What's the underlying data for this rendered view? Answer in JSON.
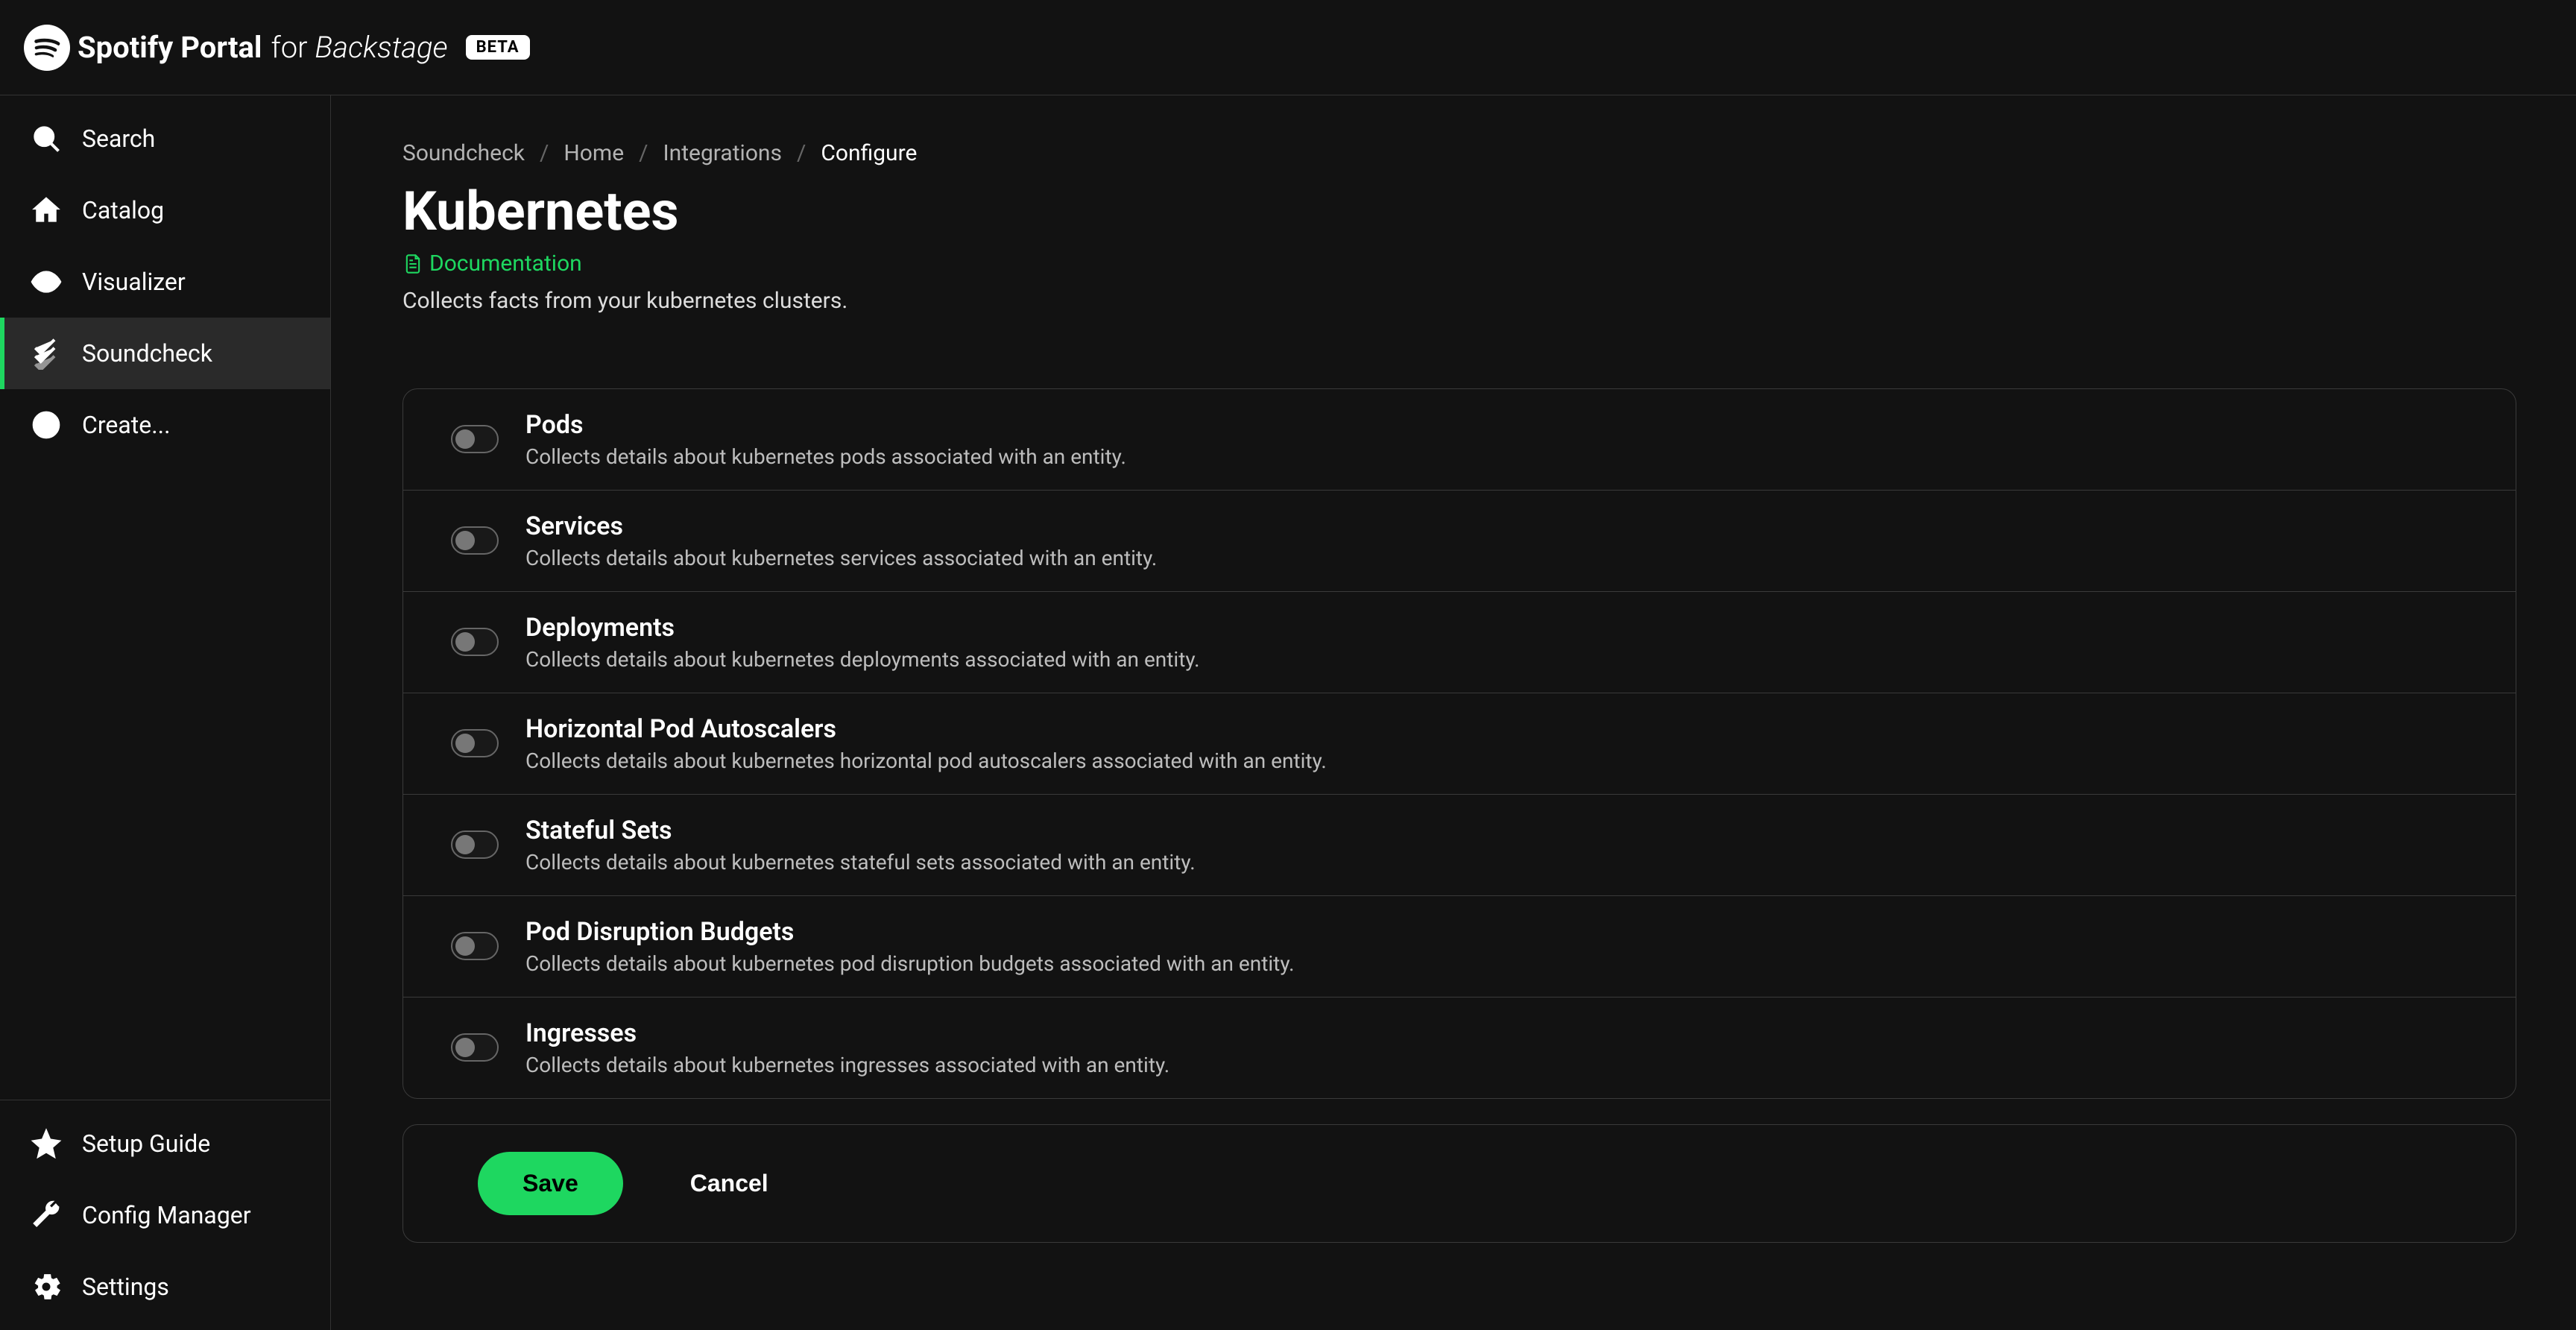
{
  "brand": {
    "name_bold": "Spotify Portal",
    "name_light_prefix": "for",
    "name_light_suffix": "Backstage",
    "badge": "BETA"
  },
  "sidebar": {
    "top": [
      {
        "label": "Search",
        "icon": "search"
      },
      {
        "label": "Catalog",
        "icon": "home"
      },
      {
        "label": "Visualizer",
        "icon": "eye"
      },
      {
        "label": "Soundcheck",
        "icon": "check-layers",
        "active": true
      },
      {
        "label": "Create...",
        "icon": "plus-circle"
      }
    ],
    "bottom": [
      {
        "label": "Setup Guide",
        "icon": "star"
      },
      {
        "label": "Config Manager",
        "icon": "wrench"
      },
      {
        "label": "Settings",
        "icon": "gear"
      }
    ]
  },
  "breadcrumbs": [
    {
      "label": "Soundcheck"
    },
    {
      "label": "Home"
    },
    {
      "label": "Integrations"
    },
    {
      "label": "Configure",
      "current": true
    }
  ],
  "page": {
    "title": "Kubernetes",
    "doc_label": "Documentation",
    "description": "Collects facts from your kubernetes clusters."
  },
  "collectors": [
    {
      "title": "Pods",
      "desc": "Collects details about kubernetes pods associated with an entity.",
      "enabled": false
    },
    {
      "title": "Services",
      "desc": "Collects details about kubernetes services associated with an entity.",
      "enabled": false
    },
    {
      "title": "Deployments",
      "desc": "Collects details about kubernetes deployments associated with an entity.",
      "enabled": false
    },
    {
      "title": "Horizontal Pod Autoscalers",
      "desc": "Collects details about kubernetes horizontal pod autoscalers associated with an entity.",
      "enabled": false
    },
    {
      "title": "Stateful Sets",
      "desc": "Collects details about kubernetes stateful sets associated with an entity.",
      "enabled": false
    },
    {
      "title": "Pod Disruption Budgets",
      "desc": "Collects details about kubernetes pod disruption budgets associated with an entity.",
      "enabled": false
    },
    {
      "title": "Ingresses",
      "desc": "Collects details about kubernetes ingresses associated with an entity.",
      "enabled": false
    }
  ],
  "actions": {
    "save": "Save",
    "cancel": "Cancel"
  }
}
